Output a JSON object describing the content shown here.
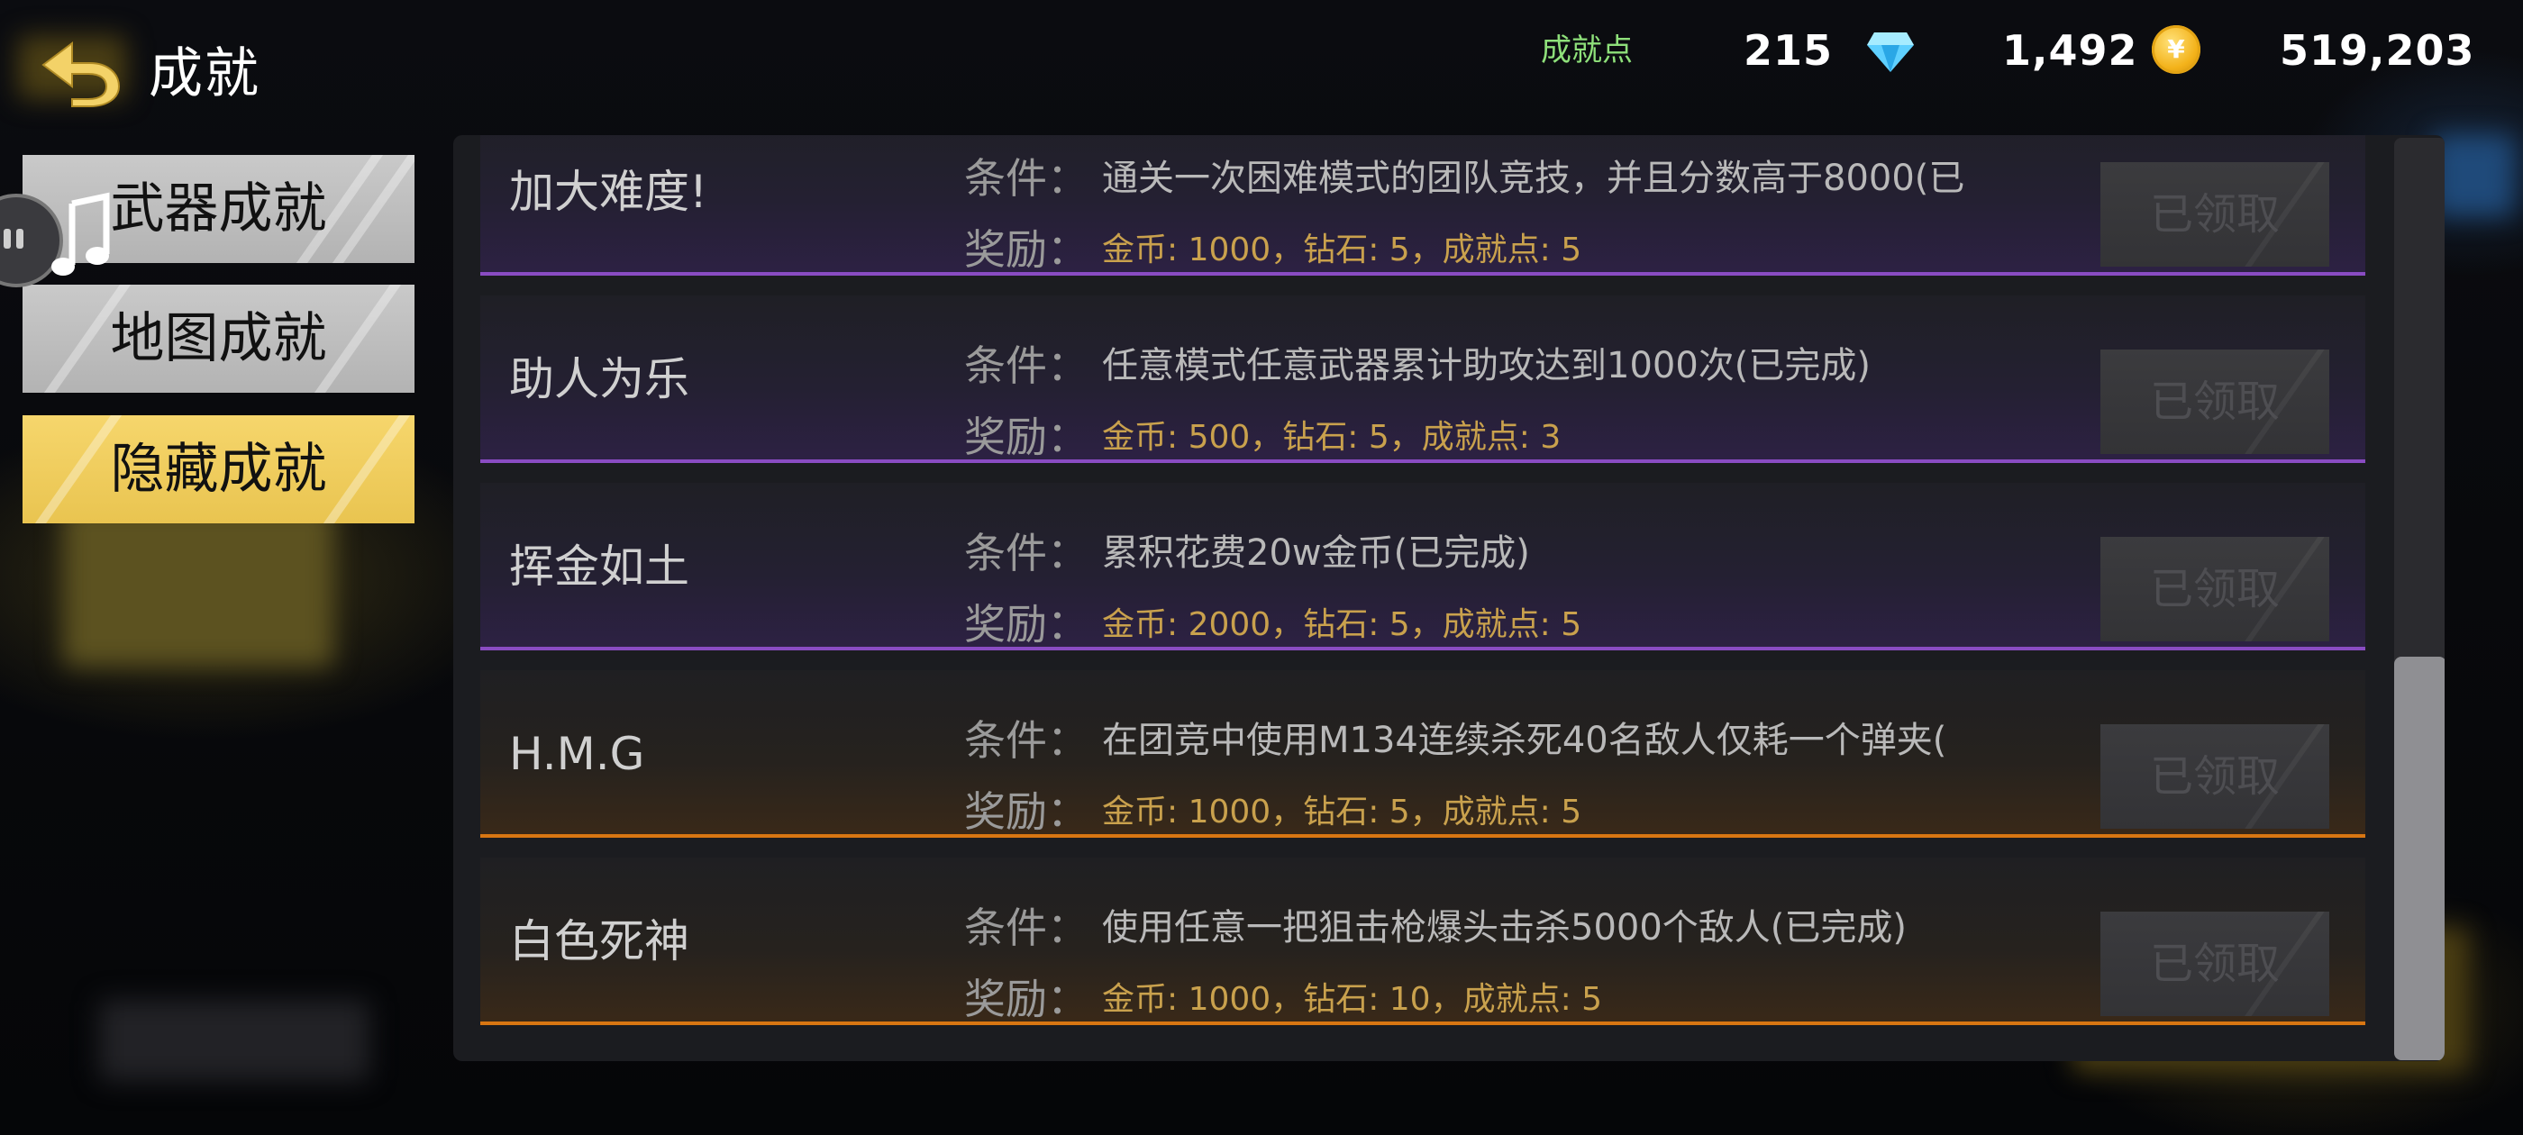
{
  "header": {
    "title": "成就",
    "achievement_points_label": "成就点",
    "achievement_points": "215",
    "diamonds": "1,492",
    "coins": "519,203",
    "coin_symbol": "¥"
  },
  "tabs": [
    {
      "label": "武器成就",
      "active": false
    },
    {
      "label": "地图成就",
      "active": false
    },
    {
      "label": "隐藏成就",
      "active": true
    }
  ],
  "list": {
    "condition_label": "条件：",
    "reward_label": "奖励：",
    "items": [
      {
        "name": "加大难度!",
        "condition": "通关一次困难模式的团队竞技，并且分数高于8000(已",
        "reward": "金币: 1000，钻石: 5，成就点: 5",
        "button": "已领取",
        "frame": "purple"
      },
      {
        "name": "助人为乐",
        "condition": "任意模式任意武器累计助攻达到1000次(已完成)",
        "reward": "金币: 500，钻石: 5，成就点: 3",
        "button": "已领取",
        "frame": "purple"
      },
      {
        "name": "挥金如土",
        "condition": "累积花费20w金币(已完成)",
        "reward": "金币: 2000，钻石: 5，成就点: 5",
        "button": "已领取",
        "frame": "purple"
      },
      {
        "name": "H.M.G",
        "condition": "在团竞中使用M134连续杀死40名敌人仅耗一个弹夹(",
        "reward": "金币: 1000，钻石: 5，成就点: 5",
        "button": "已领取",
        "frame": "orange"
      },
      {
        "name": "白色死神",
        "condition": "使用任意一把狙击枪爆头击杀5000个敌人(已完成)",
        "reward": "金币: 1000，钻石: 10，成就点: 5",
        "button": "已领取",
        "frame": "orange"
      }
    ]
  },
  "colors": {
    "accent_gold": "#f3d268",
    "points_green": "#8ee07a",
    "reward_gold": "#c9a14d",
    "purple_frame": "#8a4cc3",
    "orange_frame": "#d87612"
  },
  "icons": [
    "back-arrow-icon",
    "diamond-icon",
    "coin-icon",
    "music-note-icon"
  ]
}
